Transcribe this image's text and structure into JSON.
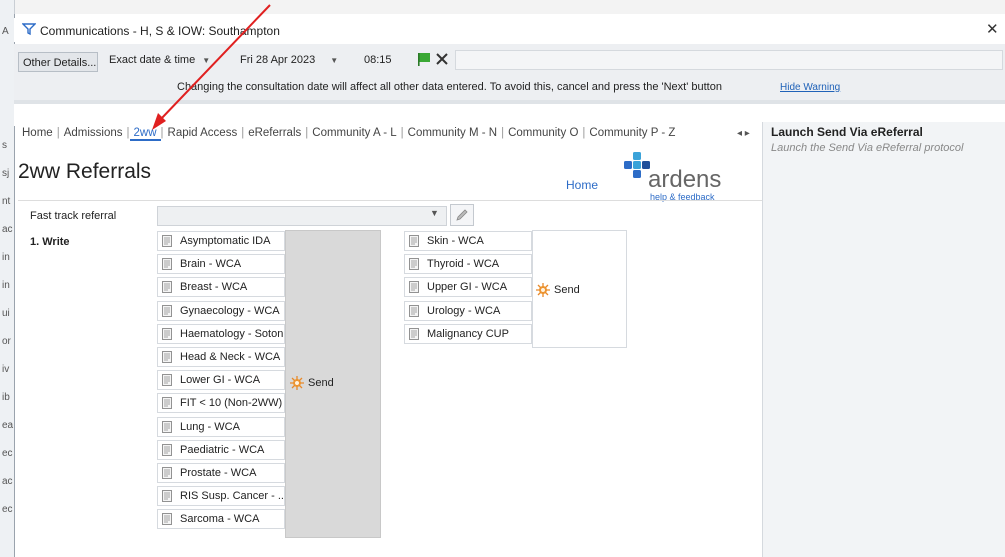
{
  "window": {
    "title": "Communications - H, S & IOW: Southampton",
    "close_glyph": "✕"
  },
  "background_letters": [
    "A",
    "s",
    "sj",
    "nt",
    "ac",
    "in",
    "in",
    "ui",
    "or",
    "iv",
    "ib",
    "ea",
    "ec",
    "ac",
    "ec"
  ],
  "toolbar": {
    "other_details": "Other Details...",
    "date_type": "Exact date & time",
    "date": "Fri 28 Apr 2023",
    "time": "08:15"
  },
  "warning": {
    "text": "Changing the consultation date will affect all other data entered. To avoid this, cancel and press the 'Next' button",
    "hide_link": "Hide Warning"
  },
  "tabs": [
    {
      "label": "Home",
      "active": false
    },
    {
      "label": "Admissions",
      "active": false
    },
    {
      "label": "2ww",
      "active": true
    },
    {
      "label": "Rapid Access",
      "active": false
    },
    {
      "label": "eReferrals",
      "active": false
    },
    {
      "label": "Community A - L",
      "active": false
    },
    {
      "label": "Community M - N",
      "active": false
    },
    {
      "label": "Community O",
      "active": false
    },
    {
      "label": "Community P - Z",
      "active": false
    }
  ],
  "right_panel": {
    "title": "Launch Send Via eReferral",
    "subtitle": "Launch the Send Via eReferral protocol"
  },
  "page": {
    "title": "2ww Referrals",
    "home_link": "Home",
    "logo_text": "ardens",
    "logo_help": "help & feedback"
  },
  "form": {
    "fast_track_label": "Fast track referral",
    "write_label": "1. Write",
    "send_label": "Send",
    "column1": [
      "Asymptomatic IDA",
      "Brain - WCA",
      "Breast - WCA",
      "Gynaecology - WCA",
      "Haematology - Soton",
      "Head & Neck - WCA",
      "Lower GI - WCA",
      "FIT < 10 (Non-2WW)",
      "Lung - WCA",
      "Paediatric - WCA",
      "Prostate - WCA",
      "RIS Susp. Cancer - ...",
      "Sarcoma - WCA"
    ],
    "column2": [
      "Skin - WCA",
      "Thyroid - WCA",
      "Upper GI - WCA",
      "Urology - WCA",
      "Malignancy CUP"
    ]
  },
  "colors": {
    "accent": "#2d6cc7",
    "annotation_arrow": "#e02020",
    "flag": "#3aa835"
  }
}
